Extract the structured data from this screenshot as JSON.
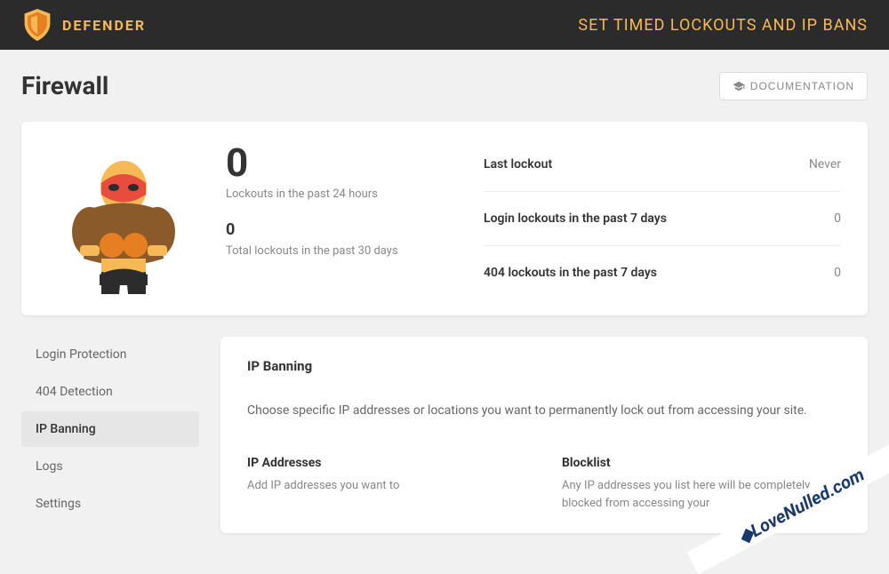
{
  "header": {
    "brand": "DEFENDER",
    "tagline": "SET TIMED LOCKOUTS AND IP BANS"
  },
  "page": {
    "title": "Firewall",
    "doc_button": "DOCUMENTATION"
  },
  "stats": {
    "lockouts_24h": {
      "value": "0",
      "label": "Lockouts in the past 24 hours"
    },
    "lockouts_30d": {
      "value": "0",
      "label": "Total lockouts in the past 30 days"
    },
    "rows": [
      {
        "key": "Last lockout",
        "value": "Never"
      },
      {
        "key": "Login lockouts in the past 7 days",
        "value": "0"
      },
      {
        "key": "404 lockouts in the past 7 days",
        "value": "0"
      }
    ]
  },
  "sidebar": {
    "items": [
      {
        "label": "Login Protection",
        "active": false
      },
      {
        "label": "404 Detection",
        "active": false
      },
      {
        "label": "IP Banning",
        "active": true
      },
      {
        "label": "Logs",
        "active": false
      },
      {
        "label": "Settings",
        "active": false
      }
    ]
  },
  "main": {
    "title": "IP Banning",
    "desc": "Choose specific IP addresses or locations you want to permanently lock out from accessing your site.",
    "sub": [
      {
        "title": "IP Addresses",
        "desc": "Add IP addresses you want to"
      },
      {
        "title": "Blocklist",
        "desc": "Any IP addresses you list here will be completely blocked from accessing your"
      }
    ]
  },
  "watermark": "LoveNulled.com"
}
